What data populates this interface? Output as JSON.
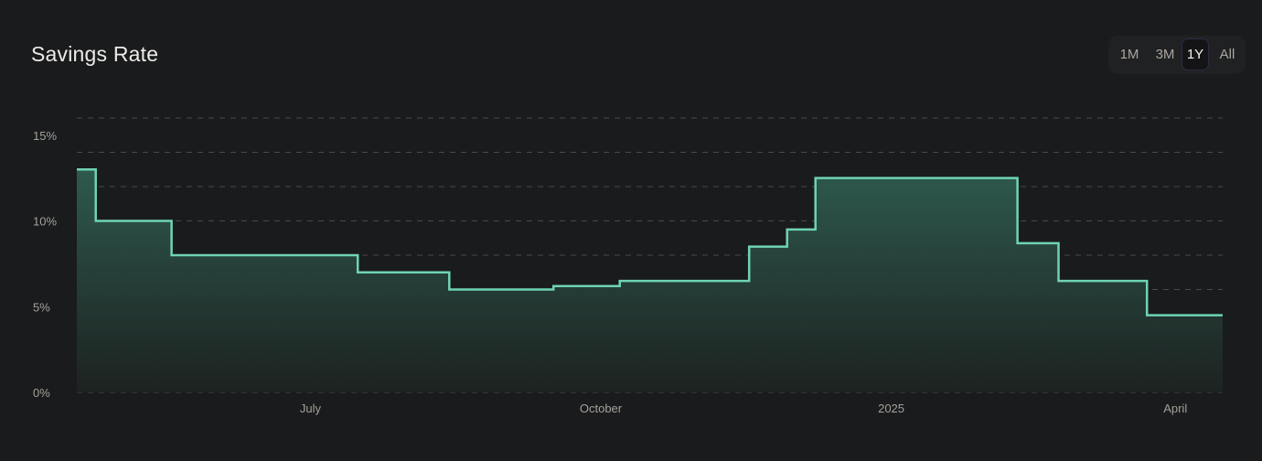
{
  "header": {
    "title": "Savings Rate"
  },
  "range_selector": {
    "options": [
      "1M",
      "3M",
      "1Y",
      "All"
    ],
    "selected": "1Y"
  },
  "colors": {
    "line": "#6fd3b5",
    "fill": "#2f5a4e",
    "grid": "#4a4a4a",
    "background": "#1a1b1d"
  },
  "chart_data": {
    "type": "area",
    "step": true,
    "title": "Savings Rate",
    "x_range": [
      "2024-04-18",
      "2025-04-16"
    ],
    "ylim": [
      0,
      16
    ],
    "y_ticks": [
      0,
      5,
      10,
      15
    ],
    "y_tick_labels": [
      "0%",
      "5%",
      "10%",
      "15%"
    ],
    "grid_lines_y": [
      0,
      2,
      4,
      6,
      8,
      10,
      12,
      14,
      16
    ],
    "x_ticks": [
      {
        "date": "2024-07-01",
        "label": "July"
      },
      {
        "date": "2024-10-01",
        "label": "October"
      },
      {
        "date": "2025-01-01",
        "label": "2025"
      },
      {
        "date": "2025-04-01",
        "label": "April"
      }
    ],
    "series": [
      {
        "name": "Savings Rate",
        "points": [
          {
            "date": "2024-04-18",
            "value": 13.0
          },
          {
            "date": "2024-04-24",
            "value": 10.0
          },
          {
            "date": "2024-05-18",
            "value": 8.0
          },
          {
            "date": "2024-07-16",
            "value": 7.0
          },
          {
            "date": "2024-08-14",
            "value": 6.0
          },
          {
            "date": "2024-09-16",
            "value": 6.2
          },
          {
            "date": "2024-10-07",
            "value": 6.5
          },
          {
            "date": "2024-11-17",
            "value": 8.5
          },
          {
            "date": "2024-11-29",
            "value": 9.5
          },
          {
            "date": "2024-12-08",
            "value": 12.5
          },
          {
            "date": "2025-02-10",
            "value": 8.7
          },
          {
            "date": "2025-02-23",
            "value": 6.5
          },
          {
            "date": "2025-03-23",
            "value": 4.5
          }
        ]
      }
    ]
  }
}
